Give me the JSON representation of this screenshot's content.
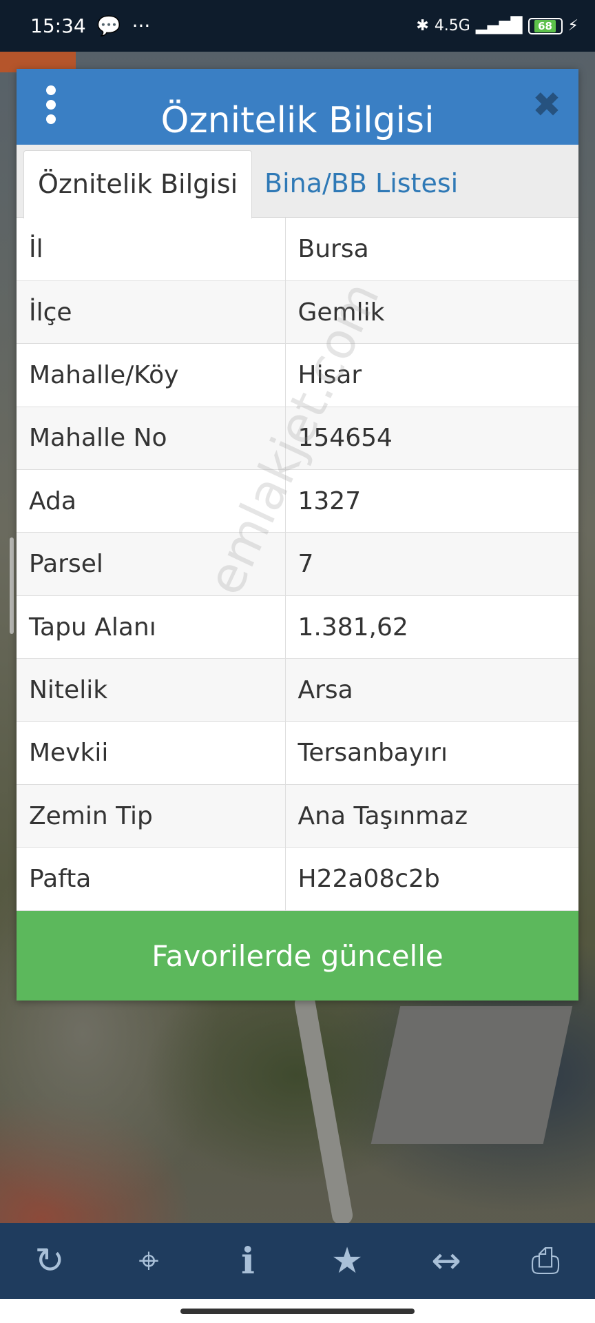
{
  "status_bar": {
    "time": "15:34",
    "more": "···",
    "network": "4.5G",
    "battery": "68"
  },
  "modal": {
    "title": "Öznitelik Bilgisi",
    "tabs": [
      {
        "label": "Öznitelik Bilgisi",
        "active": true
      },
      {
        "label": "Bina/BB Listesi",
        "active": false
      }
    ],
    "rows": [
      {
        "key": "İl",
        "value": "Bursa"
      },
      {
        "key": "İlçe",
        "value": "Gemlik"
      },
      {
        "key": "Mahalle/Köy",
        "value": "Hisar"
      },
      {
        "key": "Mahalle No",
        "value": "154654"
      },
      {
        "key": "Ada",
        "value": "1327"
      },
      {
        "key": "Parsel",
        "value": "7"
      },
      {
        "key": "Tapu Alanı",
        "value": "1.381,62"
      },
      {
        "key": "Nitelik",
        "value": "Arsa"
      },
      {
        "key": "Mevkii",
        "value": "Tersanbayırı"
      },
      {
        "key": "Zemin Tip",
        "value": "Ana Taşınmaz"
      },
      {
        "key": "Pafta",
        "value": "H22a08c2b"
      }
    ],
    "favorite_button_label": "Favorilerde güncelle"
  },
  "watermark": "emlakjet.com",
  "toolbar": {
    "icons": [
      "refresh-icon",
      "locate-crosshair-icon",
      "info-icon",
      "star-icon",
      "measure-arrows-icon",
      "print-icon"
    ]
  },
  "colors": {
    "header_blue": "#3a7fc4",
    "tab_link_blue": "#2f79b6",
    "button_green": "#5cb85c",
    "toolbar_navy": "#1f3c5e"
  }
}
